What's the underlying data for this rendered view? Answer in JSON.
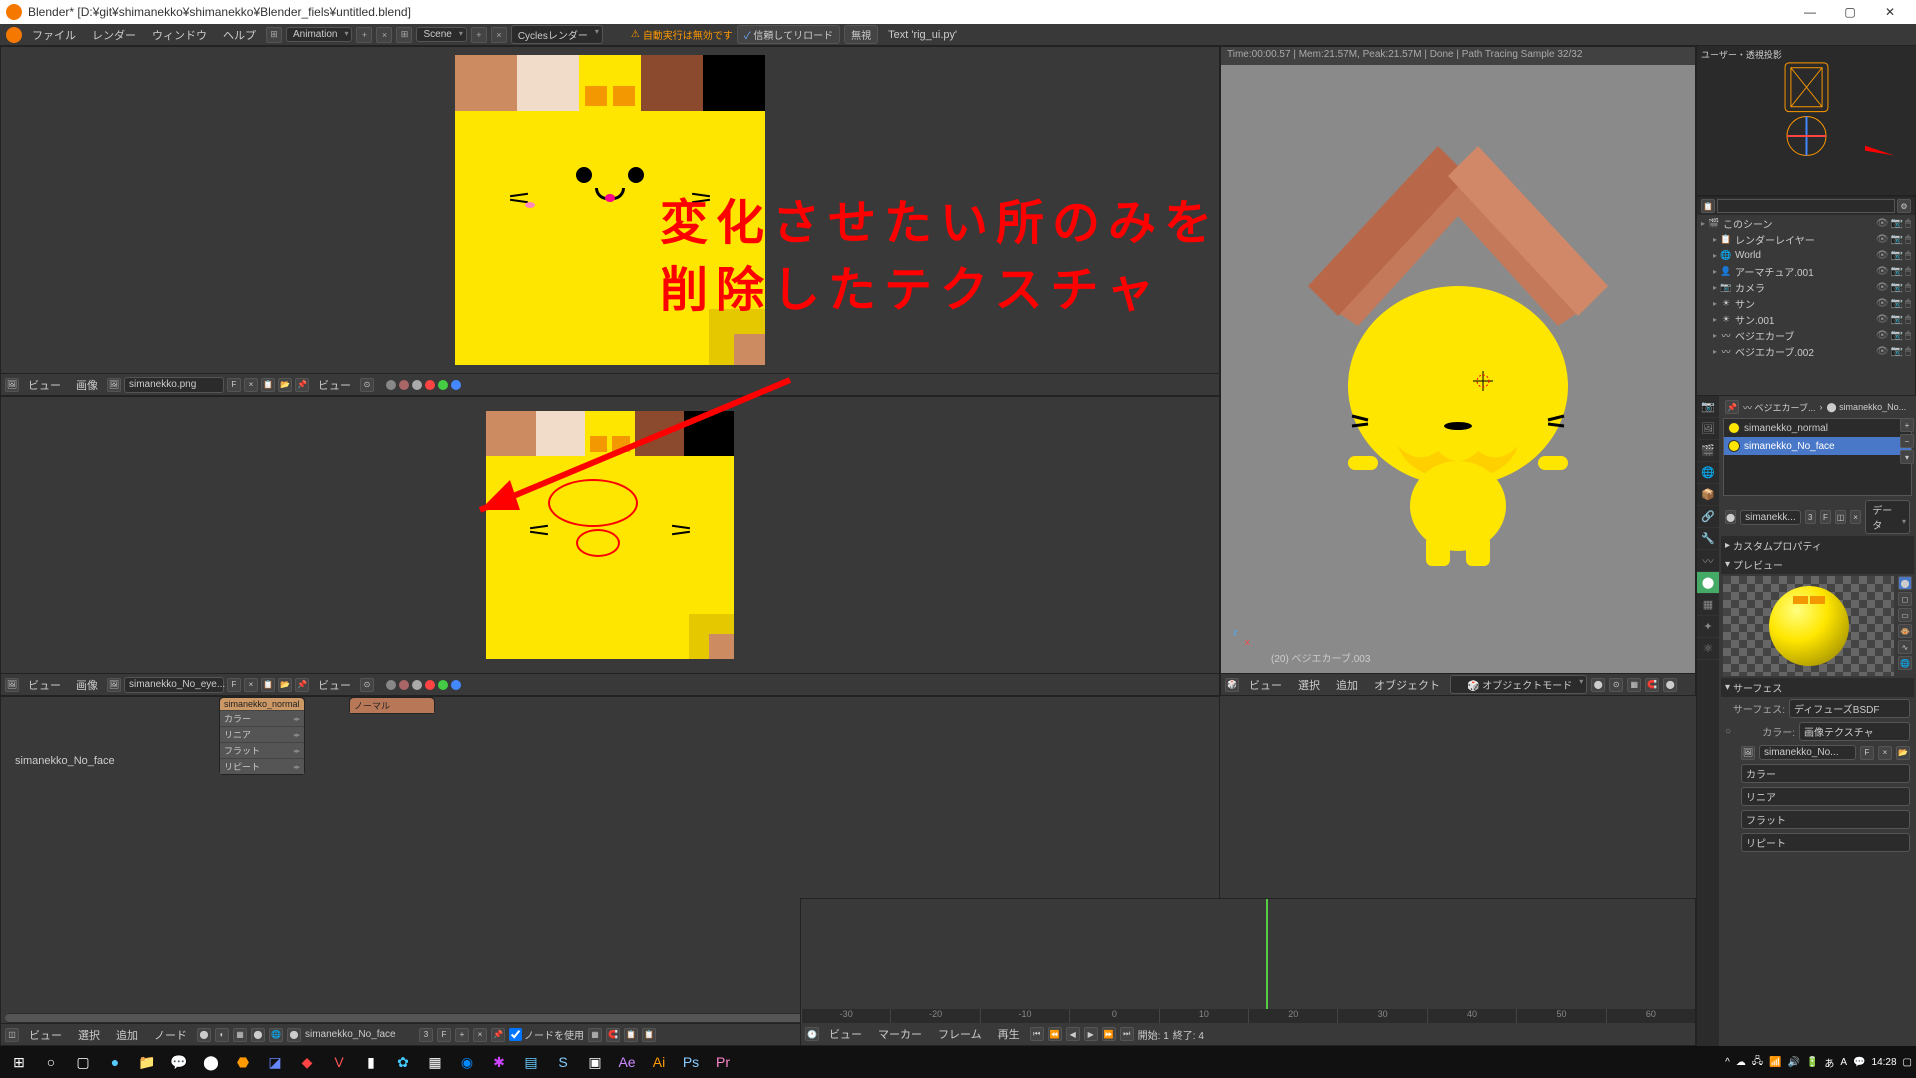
{
  "window": {
    "title": "Blender* [D:¥git¥shimanekko¥shimanekko¥Blender_fiels¥untitled.blend]"
  },
  "topmenu": {
    "file": "ファイル",
    "render": "レンダー",
    "window": "ウィンドウ",
    "help": "ヘルプ",
    "layout_dd": "Animation",
    "scene_dd": "Scene",
    "engine_dd": "Cyclesレンダー",
    "autorun": "自動実行は無効です",
    "trust": "信頼してリロード",
    "ignore": "無視",
    "textfile": "Text 'rig_ui.py'"
  },
  "imgeditor1": {
    "view": "ビュー",
    "image": "画像",
    "filename": "simanekko.png"
  },
  "imgeditor2": {
    "view": "ビュー",
    "image": "画像",
    "filename": "simanekko_No_eye..."
  },
  "viewport": {
    "stats": "Time:00:00.57 | Mem:21.57M, Peak:21.57M | Done | Path Tracing Sample 32/32",
    "objlabel": "(20) ベジエカーブ.003",
    "footer_view": "ビュー",
    "footer_select": "選択",
    "footer_add": "追加",
    "footer_object": "オブジェクト",
    "mode": "オブジェクトモード"
  },
  "miniview": {
    "label": "ユーザー・透視投影"
  },
  "annotation": {
    "line1": "変化させたい所のみを",
    "line2": "削除したテクスチャ"
  },
  "outliner": {
    "searchfield": "",
    "items": [
      {
        "label": "このシーン",
        "icon": "🎬",
        "indent": 0
      },
      {
        "label": "レンダーレイヤー",
        "icon": "📋",
        "indent": 1
      },
      {
        "label": "World",
        "icon": "🌐",
        "indent": 1
      },
      {
        "label": "アーマチュア.001",
        "icon": "👤",
        "indent": 1
      },
      {
        "label": "カメラ",
        "icon": "📷",
        "indent": 1
      },
      {
        "label": "サン",
        "icon": "☀",
        "indent": 1
      },
      {
        "label": "サン.001",
        "icon": "☀",
        "indent": 1
      },
      {
        "label": "ベジエカーブ",
        "icon": "〰",
        "indent": 1
      },
      {
        "label": "ベジエカーブ.002",
        "icon": "〰",
        "indent": 1
      }
    ]
  },
  "props": {
    "breadcrumb1": "ベジエカーブ...",
    "breadcrumb2": "simanekko_No...",
    "materials": [
      {
        "name": "simanekko_normal",
        "selected": false
      },
      {
        "name": "simanekko_No_face",
        "selected": true
      }
    ],
    "matfield": "simanekk...",
    "matcount": "3",
    "databtn": "データ",
    "custom_props": "カスタムプロパティ",
    "preview_hdr": "プレビュー",
    "surface_hdr": "サーフェス",
    "surface_lbl": "サーフェス:",
    "surface_val": "ディフューズBSDF",
    "color_lbl": "カラー:",
    "color_val": "画像テクスチャ",
    "imgfield": "simanekko_No...",
    "opt_color": "カラー",
    "opt_linear": "リニア",
    "opt_flat": "フラット",
    "opt_repeat": "リピート"
  },
  "timeline": {
    "ticks": [
      "-30",
      "-20",
      "-10",
      "0",
      "10",
      "20",
      "30",
      "40",
      "50",
      "60"
    ],
    "footer_view": "ビュー",
    "footer_marker": "マーカー",
    "footer_frame": "フレーム",
    "footer_play": "再生",
    "start_lbl": "開始:",
    "start_val": "1",
    "end_lbl": "終了:",
    "end_val": "4"
  },
  "nodeeditor": {
    "matname": "simanekko_No_face",
    "node1_hdr": "simanekko_normal",
    "node2_hdr": "ノーマル",
    "rows": [
      "カラー",
      "リニア",
      "フラット",
      "リピート"
    ],
    "footer_view": "ビュー",
    "footer_select": "選択",
    "footer_add": "追加",
    "footer_node": "ノード",
    "footer_matfield": "simanekko_No_face",
    "footer_matcount": "3",
    "footer_usenodes": "ノードを使用"
  },
  "taskbar": {
    "time": "14:28"
  }
}
